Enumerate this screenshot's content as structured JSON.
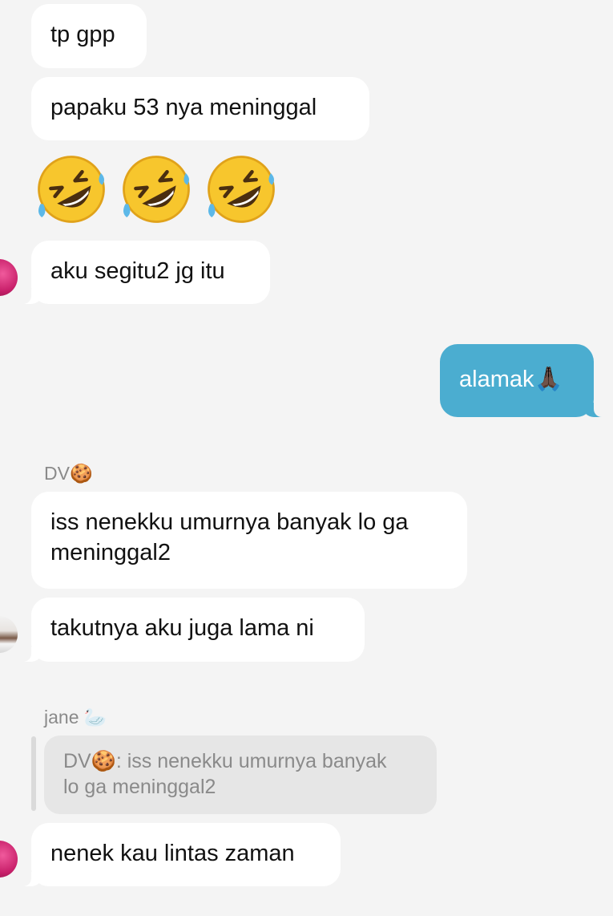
{
  "messages": {
    "m1": "tp gpp",
    "m2": "papaku 53 nya meninggal",
    "m3": "aku segitu2 jg itu",
    "out1": "alamak🙏🏿",
    "sender_dv": "DV🍪",
    "m4_line1": "iss nenekku umurnya banyak lo ga",
    "m4_line2": "meninggal2",
    "m5": "takutnya aku juga lama ni",
    "sender_jane": "jane 🦢",
    "quote_line1": "DV🍪: iss nenekku umurnya banyak",
    "quote_line2": "lo ga meninggal2",
    "m6": "nenek kau lintas zaman"
  },
  "emoji_reaction": {
    "name": "rolling-on-the-floor-laughing",
    "count": 3
  },
  "colors": {
    "background": "#f4f4f4",
    "incoming_bubble": "#ffffff",
    "outgoing_bubble": "#4badd0",
    "quote_bubble": "#e6e6e6",
    "sender_text": "#8a8a8a"
  }
}
